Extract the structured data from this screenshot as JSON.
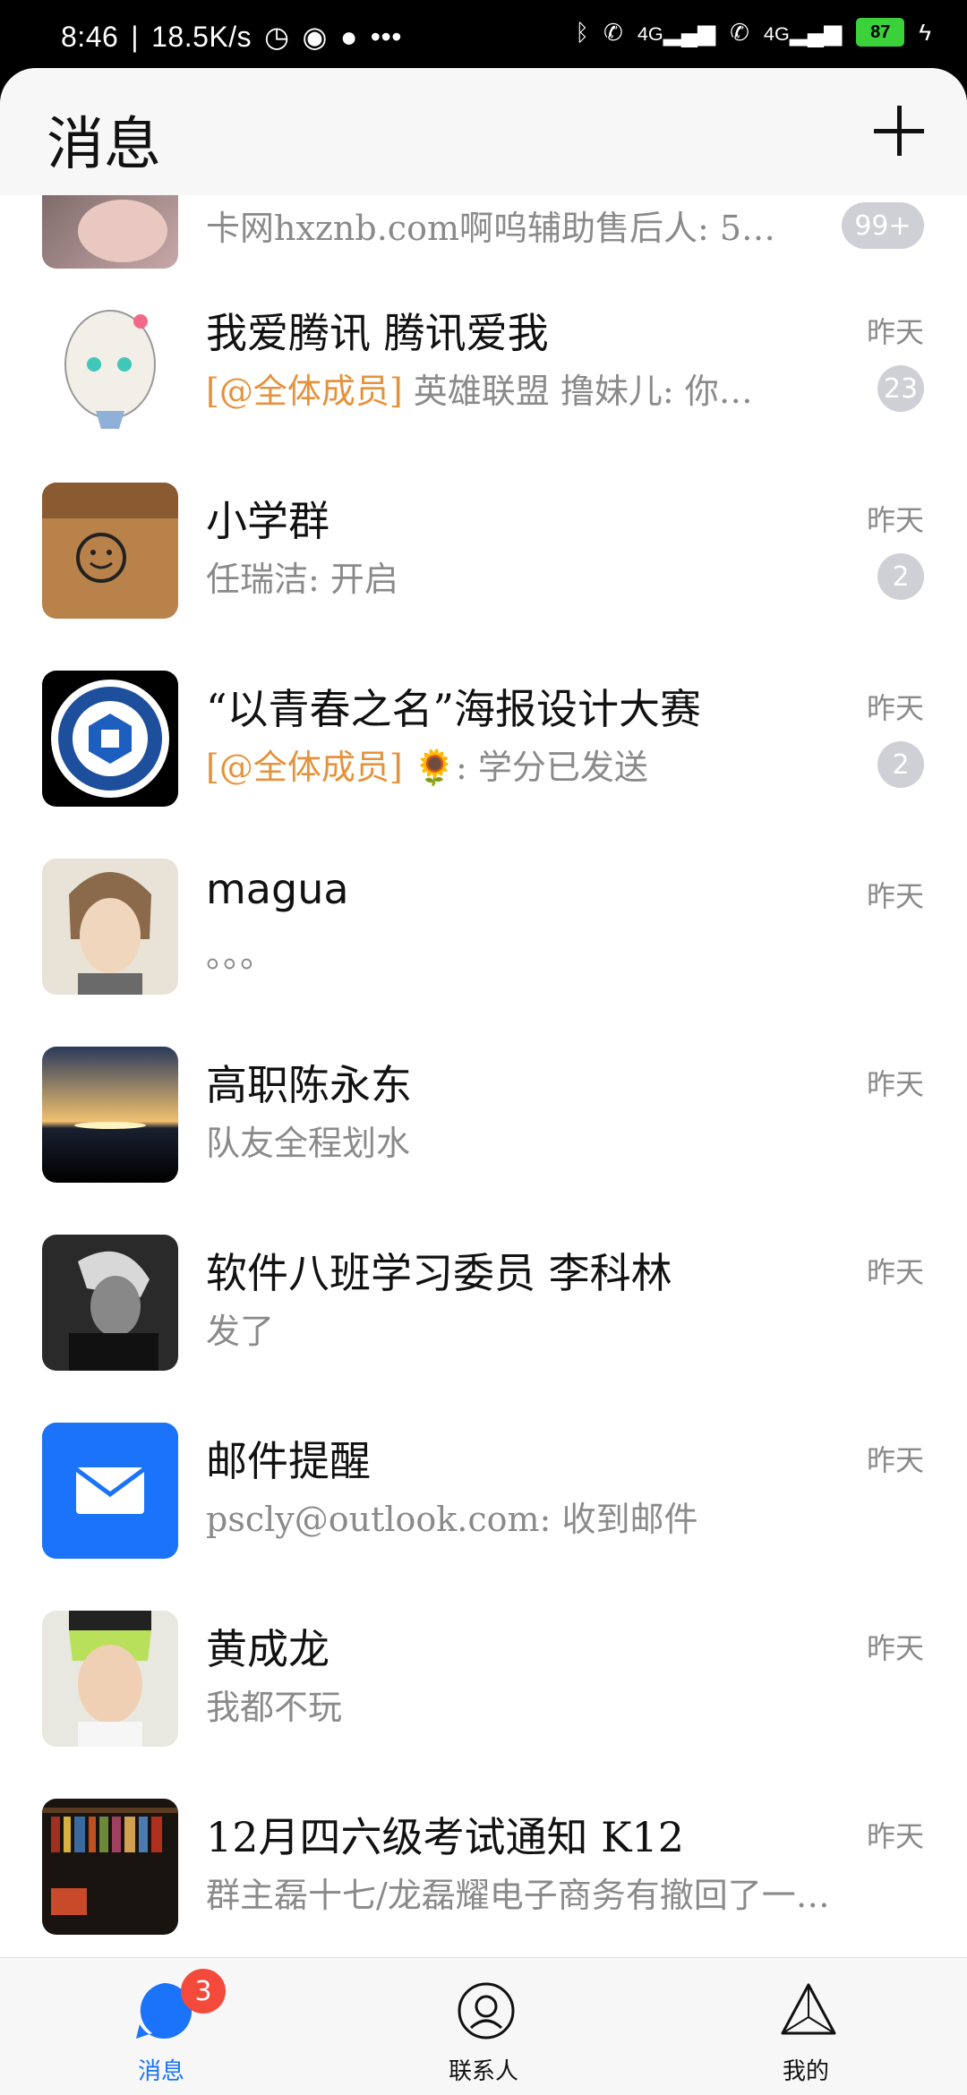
{
  "status_bar": {
    "time": "8:46",
    "speed": "18.5K/s",
    "battery": "87",
    "network1": "4G",
    "network2": "4G"
  },
  "header": {
    "title": "消息",
    "add_icon": "plus-icon"
  },
  "conversations": [
    {
      "name": "",
      "preview": "卡网hxznb.com啊呜辅助售后人: 5…",
      "time": "",
      "badge": "99+"
    },
    {
      "name": "我爱腾讯 腾讯爱我",
      "mention": "[@全体成员]",
      "preview": " 英雄联盟 撸妹儿: 你…",
      "time": "昨天",
      "badge": "23"
    },
    {
      "name": "小学群",
      "preview": "任瑞洁: 开启",
      "time": "昨天",
      "badge": "2"
    },
    {
      "name": "“以青春之名”海报设计大赛",
      "mention": "[@全体成员]",
      "preview": " 🌻: 学分已发送",
      "time": "昨天",
      "badge": "2"
    },
    {
      "name": "magua",
      "preview": "。。。",
      "time": "昨天"
    },
    {
      "name": "高职陈永东",
      "preview": "队友全程划水",
      "time": "昨天"
    },
    {
      "name": "软件八班学习委员 李科林",
      "preview": "发了",
      "time": "昨天"
    },
    {
      "name": "邮件提醒",
      "preview": "pscly@outlook.com: 收到邮件",
      "time": "昨天"
    },
    {
      "name": "黄成龙",
      "preview": "我都不玩",
      "time": "昨天"
    },
    {
      "name": "12月四六级考试通知 K12",
      "preview": "群主磊十七/龙磊耀电子商务有撤回了一…",
      "time": "昨天"
    }
  ],
  "tabbar": {
    "messages": "消息",
    "messages_badge": "3",
    "contacts": "联系人",
    "me": "我的"
  },
  "colors": {
    "accent": "#1a73f8",
    "mention": "#e6923a",
    "badge_gray": "#cfcfd6",
    "badge_red": "#f34a3c"
  }
}
